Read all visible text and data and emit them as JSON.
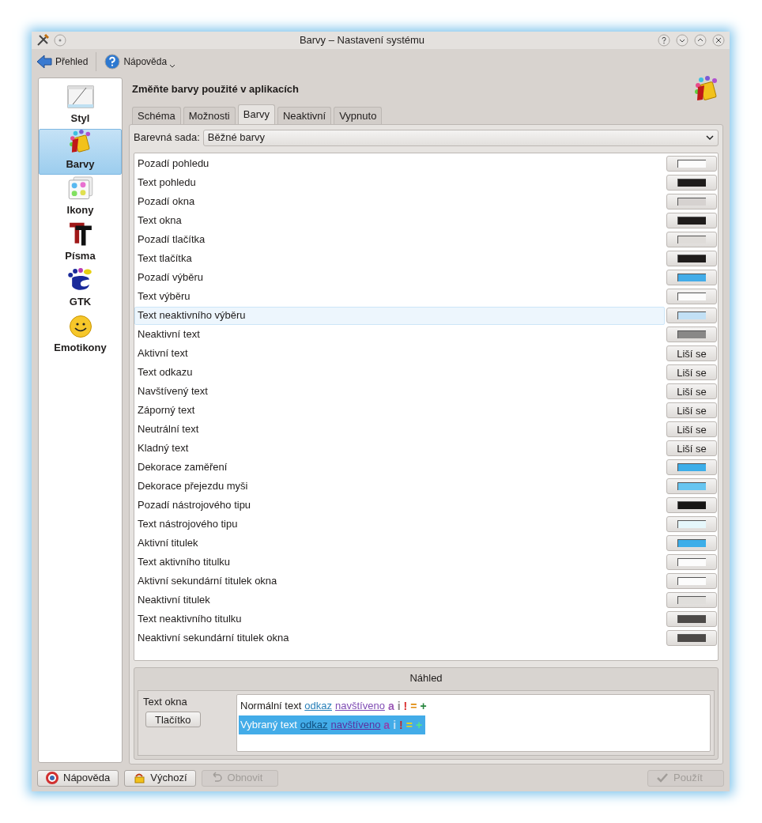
{
  "window": {
    "title": "Barvy – Nastavení systému"
  },
  "toolbar": {
    "back": "Přehled",
    "help": "Nápověda"
  },
  "sidebar": {
    "items": [
      {
        "label": "Styl",
        "selected": false
      },
      {
        "label": "Barvy",
        "selected": true
      },
      {
        "label": "Ikony",
        "selected": false
      },
      {
        "label": "Písma",
        "selected": false
      },
      {
        "label": "GTK",
        "selected": false
      },
      {
        "label": "Emotikony",
        "selected": false
      }
    ]
  },
  "header": "Změňte barvy použité v aplikacích",
  "tabs": [
    {
      "label": "Schéma",
      "selected": false
    },
    {
      "label": "Možnosti",
      "selected": false
    },
    {
      "label": "Barvy",
      "selected": true
    },
    {
      "label": "Neaktivní",
      "selected": false
    },
    {
      "label": "Vypnuto",
      "selected": false
    }
  ],
  "color_set": {
    "label": "Barevná sada:",
    "value": "Běžné barvy"
  },
  "rows": [
    {
      "name": "Pozadí pohledu",
      "kind": "swatch",
      "color": "#fcfcfc",
      "hovered": false
    },
    {
      "name": "Text pohledu",
      "kind": "swatch",
      "color": "#1f1c1b",
      "hovered": false
    },
    {
      "name": "Pozadí okna",
      "kind": "swatch",
      "color": "#d6d2d0",
      "hovered": false
    },
    {
      "name": "Text okna",
      "kind": "swatch",
      "color": "#1f1c1b",
      "hovered": false
    },
    {
      "name": "Pozadí tlačítka",
      "kind": "swatch",
      "color": "#dfdcd9",
      "hovered": false
    },
    {
      "name": "Text tlačítka",
      "kind": "swatch",
      "color": "#1f1c1b",
      "hovered": false
    },
    {
      "name": "Pozadí výběru",
      "kind": "swatch",
      "color": "#43ace8",
      "hovered": false
    },
    {
      "name": "Text výběru",
      "kind": "swatch",
      "color": "#fcfcfc",
      "hovered": false
    },
    {
      "name": "Text neaktivního výběru",
      "kind": "swatch",
      "color": "#c2e0f5",
      "hovered": true
    },
    {
      "name": "Neaktivní text",
      "kind": "swatch",
      "color": "#898887",
      "hovered": false
    },
    {
      "name": "Aktivní text",
      "kind": "varies",
      "value": "Liší se",
      "hovered": false
    },
    {
      "name": "Text odkazu",
      "kind": "varies",
      "value": "Liší se",
      "hovered": false
    },
    {
      "name": "Navštívený text",
      "kind": "varies",
      "value": "Liší se",
      "hovered": false
    },
    {
      "name": "Záporný text",
      "kind": "varies",
      "value": "Liší se",
      "hovered": false
    },
    {
      "name": "Neutrální text",
      "kind": "varies",
      "value": "Liší se",
      "hovered": false
    },
    {
      "name": "Kladný text",
      "kind": "varies",
      "value": "Liší se",
      "hovered": false
    },
    {
      "name": "Dekorace zaměření",
      "kind": "swatch",
      "color": "#3daee9",
      "hovered": false
    },
    {
      "name": "Dekorace přejezdu myši",
      "kind": "swatch",
      "color": "#67c5f0",
      "hovered": false
    },
    {
      "name": "Pozadí nástrojového tipu",
      "kind": "swatch",
      "color": "#161514",
      "hovered": false
    },
    {
      "name": "Text nástrojového tipu",
      "kind": "swatch",
      "color": "#e6f7fb",
      "hovered": false
    },
    {
      "name": "Aktivní titulek",
      "kind": "swatch",
      "color": "#3daee9",
      "hovered": false
    },
    {
      "name": "Text aktivního titulku",
      "kind": "swatch",
      "color": "#fcfcfc",
      "hovered": false
    },
    {
      "name": "Aktivní sekundární titulek okna",
      "kind": "swatch",
      "color": "#fcfcfc",
      "hovered": false
    },
    {
      "name": "Neaktivní titulek",
      "kind": "swatch",
      "color": "#e0dedb",
      "hovered": false
    },
    {
      "name": "Text neaktivního titulku",
      "kind": "swatch",
      "color": "#4d4a48",
      "hovered": false
    },
    {
      "name": "Neaktivní sekundární titulek okna",
      "kind": "swatch",
      "color": "#4d4a48",
      "hovered": false
    }
  ],
  "preview": {
    "title": "Náhled",
    "window_text": "Text okna",
    "button": "Tlačítko",
    "lines": [
      {
        "kind": "normal",
        "parts": [
          {
            "text": "Normální text",
            "kind": "text",
            "color": "#1f1c1b"
          },
          {
            "text": "odkaz",
            "kind": "link",
            "color": "#2980b9"
          },
          {
            "text": "navštíveno",
            "kind": "link",
            "color": "#7f4bb4"
          },
          {
            "text": "a",
            "kind": "symbol",
            "color": "#9b59b6"
          },
          {
            "text": "i",
            "kind": "symbol",
            "color": "#8c8a88"
          },
          {
            "text": "!",
            "kind": "symbol",
            "color": "#da2c2c"
          },
          {
            "text": "=",
            "kind": "symbol",
            "color": "#e08a0b"
          },
          {
            "text": "+",
            "kind": "symbol",
            "color": "#27863e"
          }
        ]
      },
      {
        "kind": "selected",
        "parts": [
          {
            "text": "Vybraný text",
            "kind": "text",
            "color": "#fcfcfc"
          },
          {
            "text": "odkaz",
            "kind": "link",
            "color": "#104e7e"
          },
          {
            "text": "navštíveno",
            "kind": "link",
            "color": "#5b2fa0"
          },
          {
            "text": "a",
            "kind": "symbol",
            "color": "#8e44ad"
          },
          {
            "text": "i",
            "kind": "symbol",
            "color": "#c2e0f5"
          },
          {
            "text": "!",
            "kind": "symbol",
            "color": "#c0262b"
          },
          {
            "text": "=",
            "kind": "symbol",
            "color": "#f6d50e"
          },
          {
            "text": "+",
            "kind": "symbol",
            "color": "#57e389"
          }
        ]
      }
    ]
  },
  "buttons": [
    {
      "label": "Nápověda",
      "disabled": false
    },
    {
      "label": "Výchozí",
      "disabled": false
    },
    {
      "label": "Obnovit",
      "disabled": true
    },
    {
      "label": "Použít",
      "disabled": true
    }
  ]
}
